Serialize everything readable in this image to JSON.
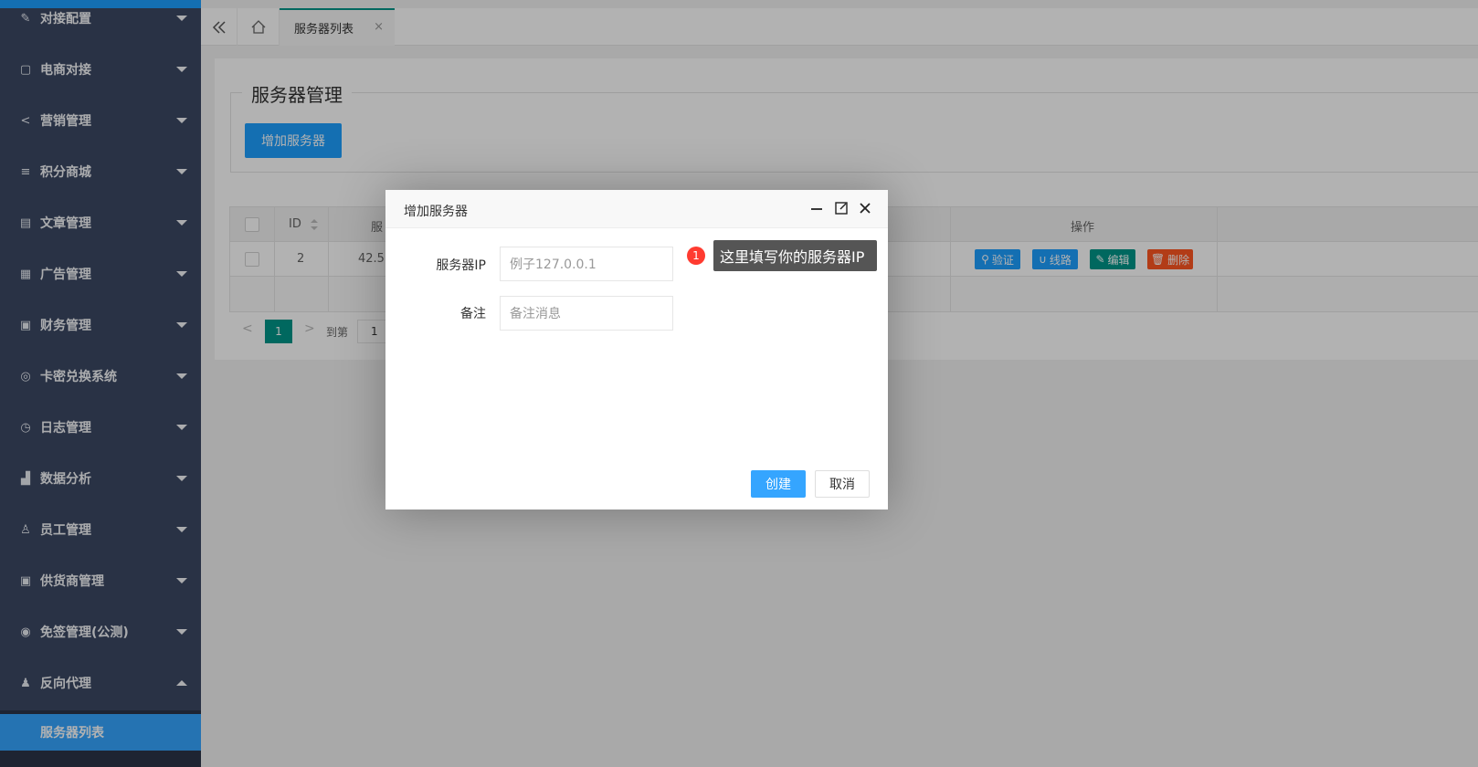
{
  "sidebar": {
    "items": [
      {
        "label": "对接配置",
        "icon": "puzzle-icon"
      },
      {
        "label": "电商对接",
        "icon": "bag-icon"
      },
      {
        "label": "营销管理",
        "icon": "share-icon"
      },
      {
        "label": "积分商城",
        "icon": "database-icon"
      },
      {
        "label": "文章管理",
        "icon": "document-icon"
      },
      {
        "label": "广告管理",
        "icon": "calendar-icon"
      },
      {
        "label": "财务管理",
        "icon": "wallet-icon"
      },
      {
        "label": "卡密兑换系统",
        "icon": "target-icon"
      },
      {
        "label": "日志管理",
        "icon": "clock-icon"
      },
      {
        "label": "数据分析",
        "icon": "chart-icon"
      },
      {
        "label": "员工管理",
        "icon": "user-icon"
      },
      {
        "label": "供货商管理",
        "icon": "box-icon"
      },
      {
        "label": "免签管理(公测)",
        "icon": "badge-icon"
      },
      {
        "label": "反向代理",
        "icon": "person-icon"
      }
    ],
    "sub_item": "服务器列表"
  },
  "tabs": {
    "active": "服务器列表",
    "close": "×"
  },
  "panel": {
    "legend": "服务器管理",
    "add_button": "增加服务器"
  },
  "table": {
    "headers": {
      "id": "ID",
      "server": "服",
      "ops": "操作"
    },
    "row": {
      "id": "2",
      "ip": "42.5"
    },
    "ops": {
      "verify": "验证",
      "route": "线路",
      "edit": "编辑",
      "delete": "删除"
    },
    "colors": {
      "verify": "#1e9fff",
      "route": "#1e9fff",
      "edit": "#009688",
      "delete": "#ff5722"
    }
  },
  "pager": {
    "current": "1",
    "goto_label": "到第",
    "goto_value": "1"
  },
  "modal": {
    "title": "增加服务器",
    "ip_label": "服务器IP",
    "ip_placeholder": "例子127.0.0.1",
    "remark_label": "备注",
    "remark_placeholder": "备注消息",
    "tip_number": "1",
    "tip_text": "这里填写你的服务器IP",
    "create": "创建",
    "cancel": "取消"
  }
}
